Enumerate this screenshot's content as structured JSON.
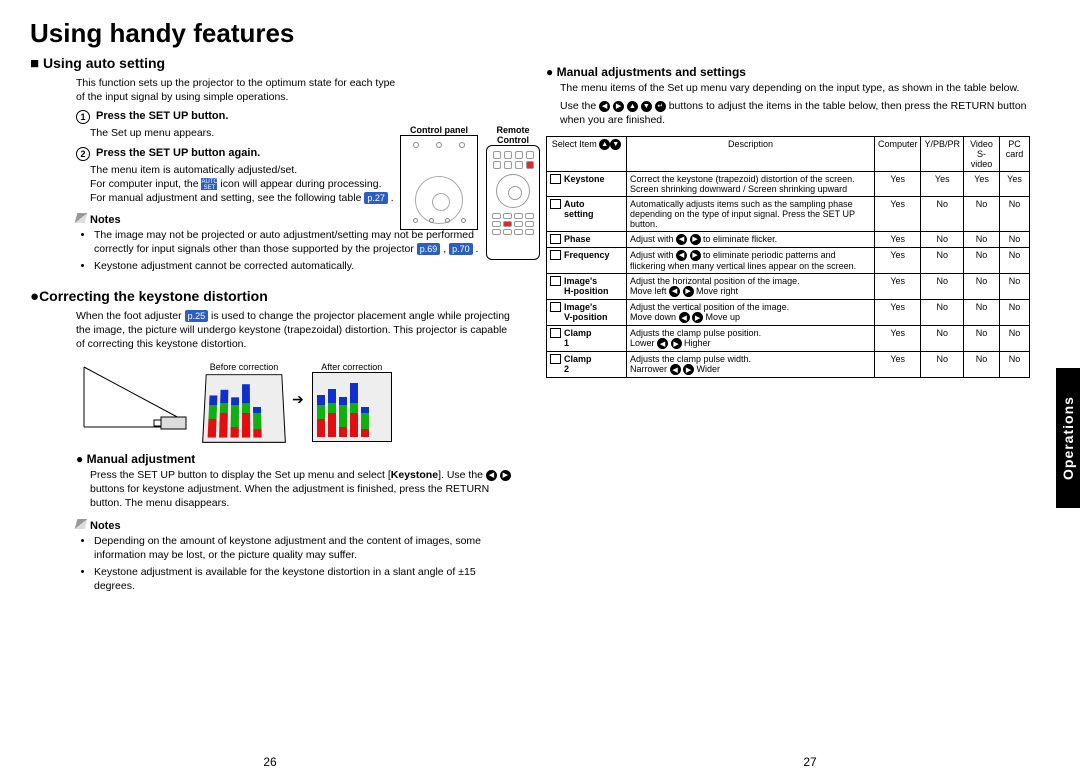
{
  "page_title": "Using handy features",
  "side_tab": "Operations",
  "page_left": "26",
  "page_right": "27",
  "left": {
    "h1": "Using auto setting",
    "intro": "This function sets up the projector to the optimum state for each type of the input signal by using simple operations.",
    "panel_label1": "Control panel",
    "panel_label2": "Remote Control",
    "step1": "Press the SET UP button.",
    "step1_body": "The Set up menu appears.",
    "step2": "Press the SET UP button again.",
    "step2_line1": "The menu item is automatically adjusted/set.",
    "step2_line2a": "For computer input, the ",
    "step2_line2b": " icon will appear during processing.",
    "step2_line3a": "For manual adjustment and setting, see the following table ",
    "ref27": "p.27",
    "notes1_head": "Notes",
    "notes1": [
      "The image may not be projected or auto adjustment/setting may not be performed correctly for input signals other than those supported by the projector ",
      "Keystone adjustment cannot be corrected automatically."
    ],
    "ref69": "p.69",
    "ref70": "p.70",
    "h2": "Correcting the keystone distortion",
    "keystone_intro_a": "When the foot adjuster ",
    "ref25": "p.25",
    "keystone_intro_b": " is used to change the projector placement angle while projecting the image, the picture will undergo keystone (trapezoidal) distortion. This projector is capable of correcting this keystone distortion.",
    "before": "Before correction",
    "after": "After correction",
    "manual_head": "Manual adjustment",
    "manual_body_a": "Press the SET UP button to display the Set up menu and select [",
    "manual_body_key": "Keystone",
    "manual_body_b": "]. Use the ",
    "manual_body_c": " buttons for keystone adjustment. When the adjustment is finished, press the RETURN button. The menu disappears.",
    "notes2_head": "Notes",
    "notes2": [
      "Depending on the amount of keystone adjustment and the content of images, some information may be lost, or the picture quality may suffer.",
      "Keystone adjustment is available for the keystone distortion in a slant angle of ±15 degrees."
    ]
  },
  "right": {
    "h1": "Manual adjustments and settings",
    "intro": "The menu items of the Set up menu vary depending on the input type, as shown in the table below.",
    "use_a": "Use the ",
    "use_b": " buttons to adjust the items in the table below, then press the RETURN button when you are finished.",
    "th_select": "Select Item",
    "th_desc": "Description",
    "th_c1": "Computer",
    "th_c2": "Y/PB/PR",
    "th_c3": "Video S-video",
    "th_c4": "PC card",
    "rows": [
      {
        "name": "Keystone",
        "desc": "Correct the keystone (trapezoid) distortion of the screen.",
        "extra": "Screen shrinking downward / Screen shrinking upward",
        "c": [
          "Yes",
          "Yes",
          "Yes",
          "Yes"
        ]
      },
      {
        "name": "Auto setting",
        "desc": "Automatically adjusts items such as the sampling phase depending on the type of input signal. Press the SET UP button.",
        "extra": "",
        "c": [
          "Yes",
          "No",
          "No",
          "No"
        ]
      },
      {
        "name": "Phase",
        "desc": "Adjust with ◀ ▶ to eliminate flicker.",
        "extra": "",
        "c": [
          "Yes",
          "No",
          "No",
          "No"
        ]
      },
      {
        "name": "Frequency",
        "desc": "Adjust with ◀ ▶ to eliminate periodic patterns and flickering when many vertical lines appear on the screen.",
        "extra": "",
        "c": [
          "Yes",
          "No",
          "No",
          "No"
        ]
      },
      {
        "name": "Image's H-position",
        "desc": "Adjust the horizontal position of the image.",
        "extra": "Move left ◀ ▶ Move right",
        "c": [
          "Yes",
          "No",
          "No",
          "No"
        ]
      },
      {
        "name": "Image's V-position",
        "desc": "Adjust the vertical position of the image.",
        "extra": "Move down ◀ ▶ Move up",
        "c": [
          "Yes",
          "No",
          "No",
          "No"
        ]
      },
      {
        "name": "Clamp 1",
        "desc": "Adjusts the clamp pulse position.",
        "extra": "Lower ◀ ▶ Higher",
        "c": [
          "Yes",
          "No",
          "No",
          "No"
        ]
      },
      {
        "name": "Clamp 2",
        "desc": "Adjusts the clamp pulse width.",
        "extra": "Narrower ◀ ▶ Wider",
        "c": [
          "Yes",
          "No",
          "No",
          "No"
        ]
      }
    ]
  }
}
